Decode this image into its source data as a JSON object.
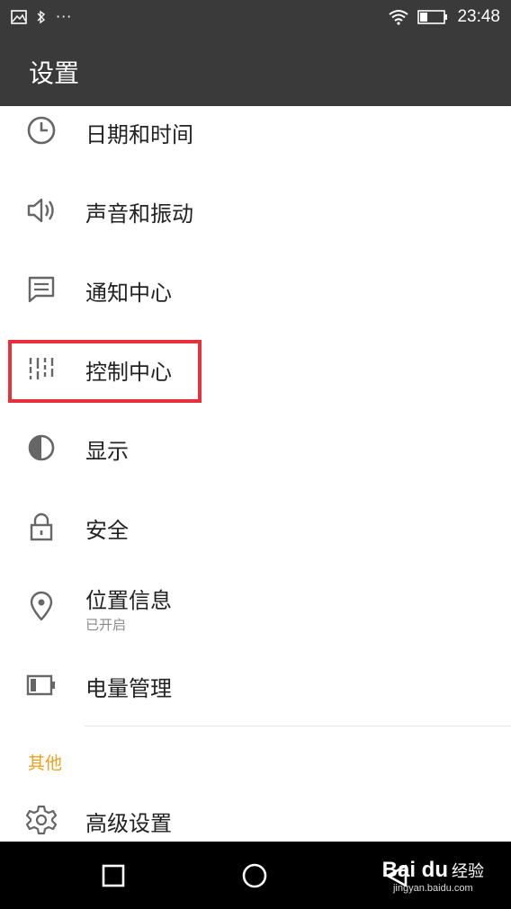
{
  "status_bar": {
    "time": "23:48",
    "more": "···",
    "icons": [
      "image-icon",
      "bluetooth-icon",
      "wifi-icon",
      "battery-icon"
    ]
  },
  "app_bar": {
    "title": "设置"
  },
  "items": [
    {
      "label": "日期和时间",
      "icon": "clock-icon"
    },
    {
      "label": "声音和振动",
      "icon": "speaker-icon"
    },
    {
      "label": "通知中心",
      "icon": "message-icon"
    },
    {
      "label": "控制中心",
      "icon": "sliders-icon"
    },
    {
      "label": "显示",
      "icon": "contrast-icon"
    },
    {
      "label": "安全",
      "icon": "lock-icon"
    },
    {
      "label": "位置信息",
      "sublabel": "已开启",
      "icon": "location-pin-icon"
    },
    {
      "label": "电量管理",
      "icon": "battery-level-icon"
    }
  ],
  "section_other": {
    "title": "其他",
    "items": [
      {
        "label": "高级设置",
        "icon": "gear-icon"
      }
    ]
  },
  "nav_bar": {
    "buttons": [
      "recents-button",
      "home-button",
      "back-button"
    ]
  },
  "watermark": {
    "logo": "Bai du",
    "text": "经验",
    "url": "jingyan.baidu.com"
  },
  "colors": {
    "header_bg": "#3a3a3a",
    "section_accent": "#f0a020",
    "highlight_border": "#e8303a",
    "icon_gray": "#666666"
  }
}
